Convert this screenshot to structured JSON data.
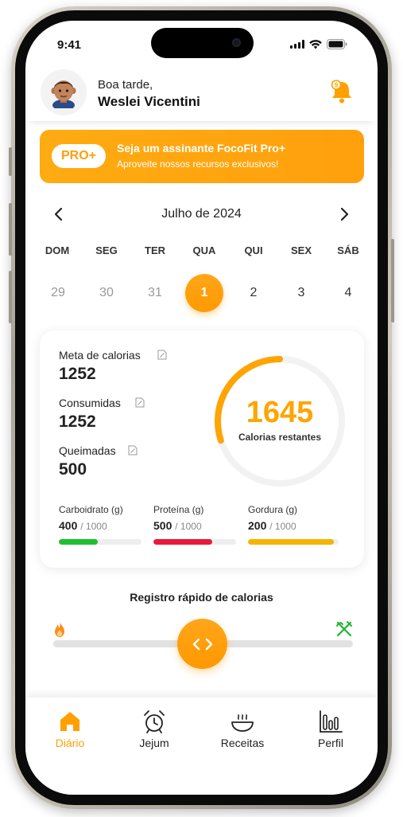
{
  "status_bar": {
    "time": "9:41"
  },
  "header": {
    "greeting": "Boa tarde,",
    "user_name": "Weslei Vicentini",
    "notification_count": "9"
  },
  "pro_banner": {
    "badge": "PRO+",
    "title": "Seja um assinante FocoFit Pro+",
    "subtitle": "Aproveite nossos recursos exclusivos!"
  },
  "calendar": {
    "month": "Julho de 2024",
    "days": [
      {
        "label": "DOM",
        "number": "29",
        "state": "past"
      },
      {
        "label": "SEG",
        "number": "30",
        "state": "past"
      },
      {
        "label": "TER",
        "number": "31",
        "state": "past"
      },
      {
        "label": "QUA",
        "number": "1",
        "state": "selected"
      },
      {
        "label": "QUI",
        "number": "2",
        "state": "future"
      },
      {
        "label": "SEX",
        "number": "3",
        "state": "future"
      },
      {
        "label": "SÁB",
        "number": "4",
        "state": "future"
      }
    ]
  },
  "calories": {
    "goal_label": "Meta de calorias",
    "goal_value": "1252",
    "consumed_label": "Consumidas",
    "consumed_value": "1252",
    "burned_label": "Queimadas",
    "burned_value": "500",
    "remaining_value": "1645",
    "remaining_label": "Calorias restantes",
    "ring_progress": 0.3
  },
  "macros": [
    {
      "label": "Carboidrato (g)",
      "value": "400",
      "total": "/ 1000",
      "progress": 0.47,
      "color": "#1fbf2f"
    },
    {
      "label": "Proteína (g)",
      "value": "500",
      "total": "/ 1000",
      "progress": 0.71,
      "color": "#e8193c"
    },
    {
      "label": "Gordura (g)",
      "value": "200",
      "total": "/ 1000",
      "progress": 0.95,
      "color": "#f5b400"
    }
  ],
  "quick_log": {
    "title": "Registro rápido de calorias"
  },
  "tabs": [
    {
      "label": "Diário",
      "icon": "home-icon",
      "active": true
    },
    {
      "label": "Jejum",
      "icon": "alarm-clock-icon",
      "active": false
    },
    {
      "label": "Receitas",
      "icon": "bowl-icon",
      "active": false
    },
    {
      "label": "Perfil",
      "icon": "bar-chart-icon",
      "active": false
    }
  ],
  "colors": {
    "accent": "#ffa000",
    "carbs": "#1fbf2f",
    "protein": "#e8193c",
    "fat": "#f5b400",
    "burn": "#ff8c1a",
    "food": "#22b530"
  }
}
